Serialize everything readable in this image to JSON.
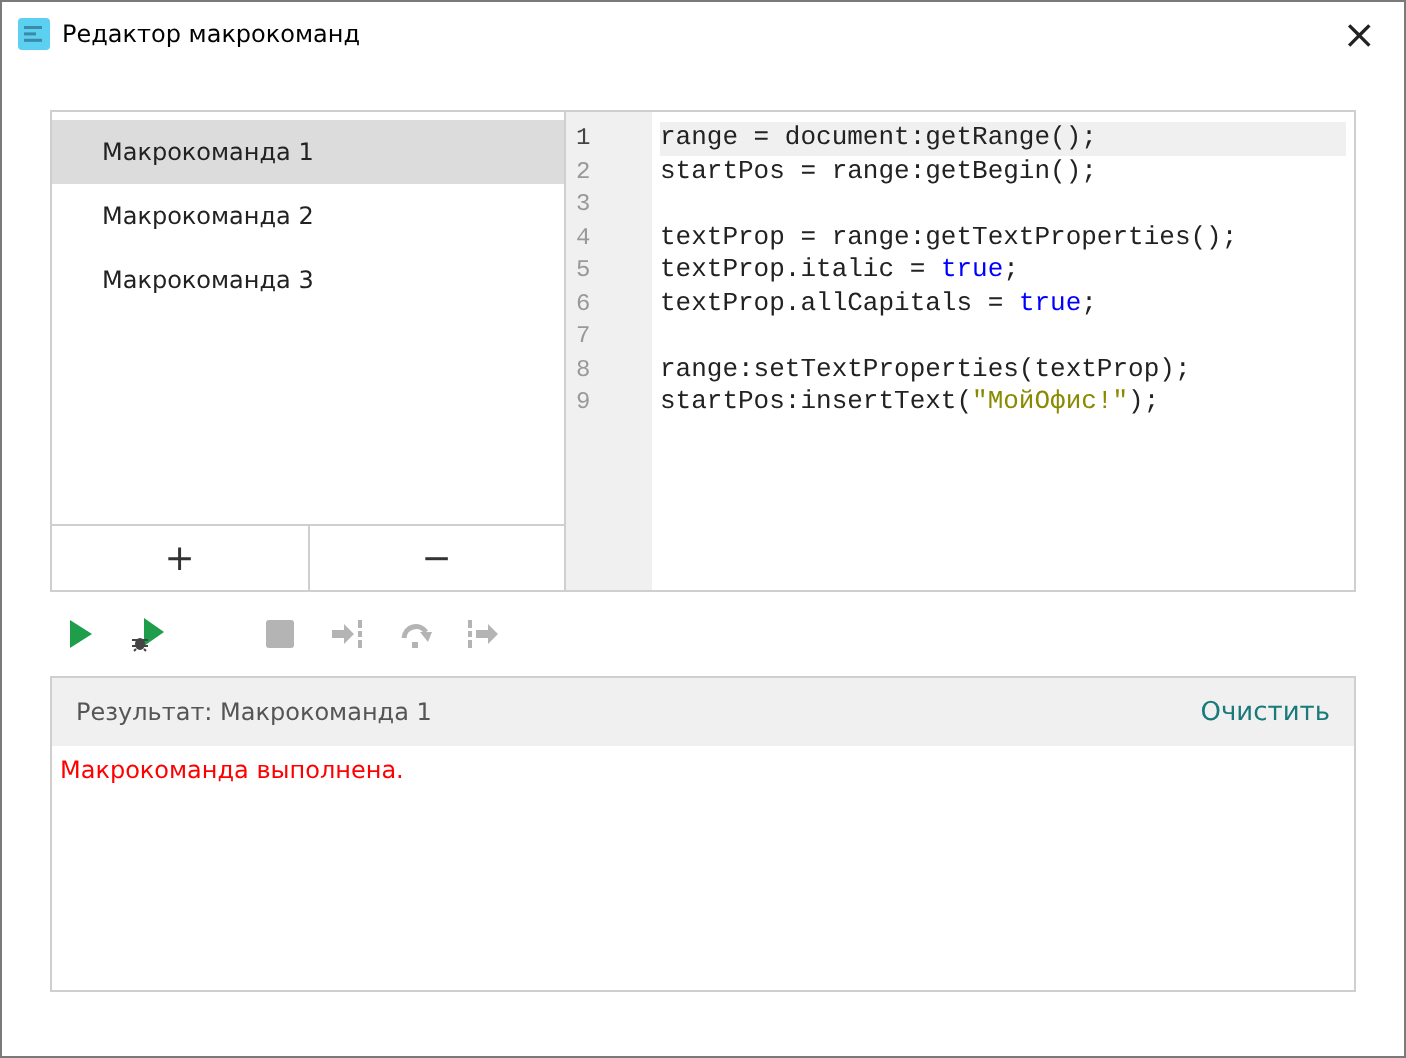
{
  "window": {
    "title": "Редактор макрокоманд",
    "close": "×"
  },
  "macros": [
    {
      "label": "Макрокоманда 1",
      "selected": true
    },
    {
      "label": "Макрокоманда 2",
      "selected": false
    },
    {
      "label": "Макрокоманда 3",
      "selected": false
    }
  ],
  "list_buttons": [
    {
      "label": "+"
    },
    {
      "label": "−"
    }
  ],
  "code": [
    {
      "number": "1",
      "current": true,
      "tokens": [
        {
          "kind": "plain",
          "text": "range = document:getRange();"
        }
      ]
    },
    {
      "number": "2",
      "current": false,
      "tokens": [
        {
          "kind": "plain",
          "text": "startPos = range:getBegin();"
        }
      ]
    },
    {
      "number": "3",
      "current": false
    },
    {
      "number": "4",
      "current": false,
      "tokens": [
        {
          "kind": "plain",
          "text": "textProp = range:getTextProperties();"
        }
      ]
    },
    {
      "number": "5",
      "current": false,
      "tokens": [
        {
          "kind": "plain",
          "text": "textProp.italic = "
        },
        {
          "kind": "keyword",
          "text": "true"
        },
        {
          "kind": "plain",
          "text": ";"
        }
      ]
    },
    {
      "number": "6",
      "current": false,
      "tokens": [
        {
          "kind": "plain",
          "text": "textProp.allCapitals = "
        },
        {
          "kind": "keyword",
          "text": "true"
        },
        {
          "kind": "plain",
          "text": ";"
        }
      ]
    },
    {
      "number": "7",
      "current": false
    },
    {
      "number": "8",
      "current": false,
      "tokens": [
        {
          "kind": "plain",
          "text": "range:setTextProperties(textProp);"
        }
      ]
    },
    {
      "number": "9",
      "current": false,
      "tokens": [
        {
          "kind": "plain",
          "text": "startPos:insertText("
        },
        {
          "kind": "string",
          "text": "\"МойОфис!\""
        },
        {
          "kind": "plain",
          "text": ");"
        }
      ]
    }
  ],
  "toolbar": [
    {
      "kind": "run",
      "disabled": false
    },
    {
      "kind": "debug",
      "disabled": false
    },
    {
      "kind": "gap"
    },
    {
      "kind": "stop",
      "disabled": true
    },
    {
      "kind": "step-into",
      "disabled": true
    },
    {
      "kind": "step-over",
      "disabled": true
    },
    {
      "kind": "step-out",
      "disabled": true
    }
  ],
  "result": {
    "title": "Результат: Макрокоманда 1",
    "clear_button": "Очистить",
    "message": "Макрокоманда выполнена."
  }
}
